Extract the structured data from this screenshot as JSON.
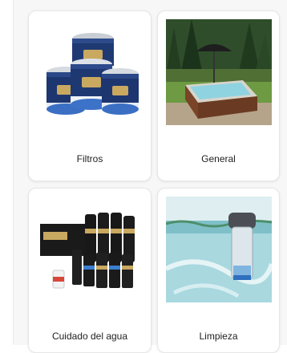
{
  "categories": [
    {
      "id": "filtros",
      "label": "Filtros",
      "image": "spa-filter-cartridges"
    },
    {
      "id": "general",
      "label": "General",
      "image": "outdoor-hot-tub-with-umbrella"
    },
    {
      "id": "agua",
      "label": "Cuidado del agua",
      "image": "water-care-chemical-bottles"
    },
    {
      "id": "limpieza",
      "label": "Limpieza",
      "image": "underwater-cleaning-device"
    }
  ]
}
